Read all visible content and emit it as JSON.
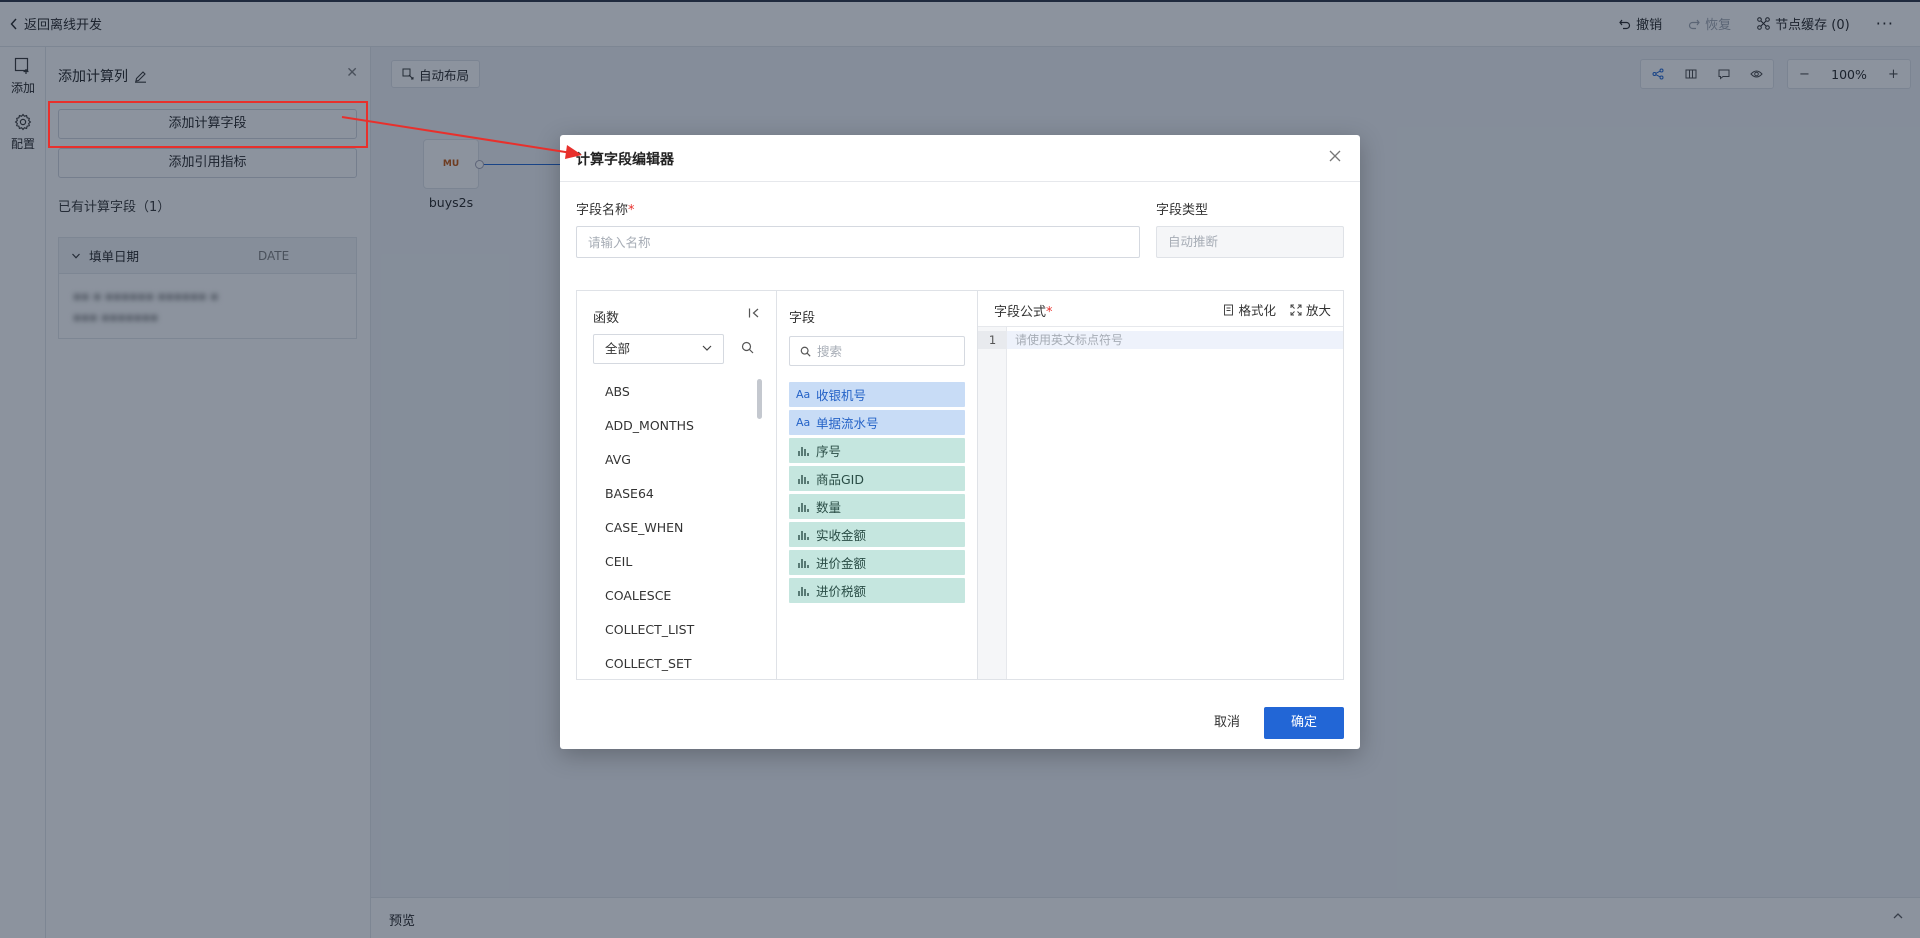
{
  "topbar": {
    "back_label": "返回离线开发",
    "undo_label": "撤销",
    "redo_label": "恢复",
    "node_cache_label": "节点缓存 (0)"
  },
  "rail": {
    "add_label": "添加",
    "config_label": "配置"
  },
  "panel": {
    "title": "添加计算列",
    "add_calc_field_label": "添加计算字段",
    "add_ref_metric_label": "添加引用指标",
    "existing_label": "已有计算字段（1）",
    "field_name": "填单日期",
    "field_type": "DATE"
  },
  "canvas": {
    "auto_layout_label": "自动布局",
    "zoom": "100%",
    "node_label": "buys2s",
    "node_logo_text": "MU"
  },
  "preview": {
    "label": "预览"
  },
  "dialog": {
    "title": "计算字段编辑器",
    "field_name_label": "字段名称",
    "field_name_placeholder": "请输入名称",
    "field_type_label": "字段类型",
    "field_type_value": "自动推断",
    "functions": {
      "title": "函数",
      "category_selected": "全部",
      "items": [
        "ABS",
        "ADD_MONTHS",
        "AVG",
        "BASE64",
        "CASE_WHEN",
        "CEIL",
        "COALESCE",
        "COLLECT_LIST",
        "COLLECT_SET"
      ]
    },
    "fields": {
      "title": "字段",
      "search_placeholder": "搜索",
      "items": [
        {
          "type_glyph": "Aa",
          "kind": "dim",
          "label": "收银机号"
        },
        {
          "type_glyph": "",
          "kind": "dim",
          "label": "单据流水号"
        },
        {
          "type_glyph": "",
          "kind": "meas",
          "label": "序号"
        },
        {
          "type_glyph": "",
          "kind": "meas",
          "label": "商品GID"
        },
        {
          "type_glyph": "",
          "kind": "meas",
          "label": "数量"
        },
        {
          "type_glyph": "",
          "kind": "meas",
          "label": "实收金额"
        },
        {
          "type_glyph": "",
          "kind": "meas",
          "label": "进价金额"
        },
        {
          "type_glyph": "",
          "kind": "meas",
          "label": "进价税额"
        }
      ]
    },
    "formula": {
      "title": "字段公式",
      "format_label": "格式化",
      "expand_label": "放大",
      "line_number": "1",
      "placeholder": "请使用英文标点符号"
    },
    "cancel_label": "取消",
    "ok_label": "确定"
  }
}
